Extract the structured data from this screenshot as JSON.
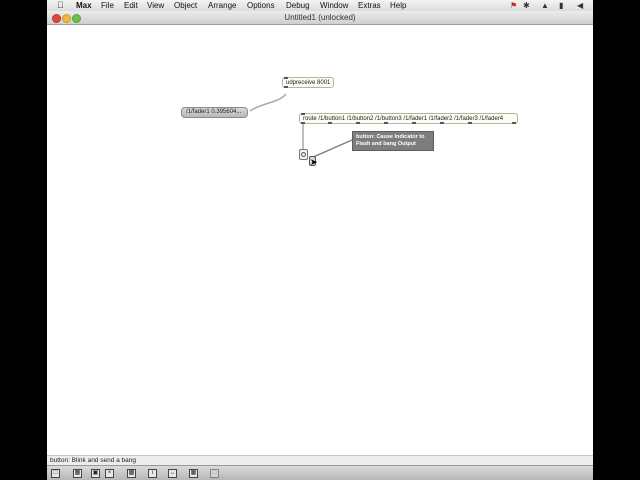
{
  "menubar": {
    "app": "Max",
    "items": [
      "File",
      "Edit",
      "View",
      "Object",
      "Arrange",
      "Options",
      "Debug",
      "Window",
      "Extras",
      "Help"
    ]
  },
  "window": {
    "title": "Untitled1 (unlocked)"
  },
  "patcher": {
    "udpreceive": "udpreceive 8001",
    "message": "/1/fader1 0.395604...",
    "route": "route /1/button1 /1/button2 /1/button3 /1/fader1 /1/fader2 /1/fader3 /1/fader4",
    "tooltip": "button: Cause Indicator to Flash and bang Output"
  },
  "status": {
    "text": "button: Blink and send a bang"
  },
  "colors": {
    "canvas": "#ffffff",
    "object_border": "#b4b4a0",
    "patch_cord": "#aaaaaa",
    "tooltip_bg": "#7d7d7d"
  },
  "icons": {
    "toolbar": [
      "lock-icon",
      "presentation-icon",
      "snap-grid-icon",
      "clear-icon",
      "new-object-icon",
      "inspector-icon",
      "toggle-icon",
      "grid-icon",
      "extra-icon"
    ]
  }
}
